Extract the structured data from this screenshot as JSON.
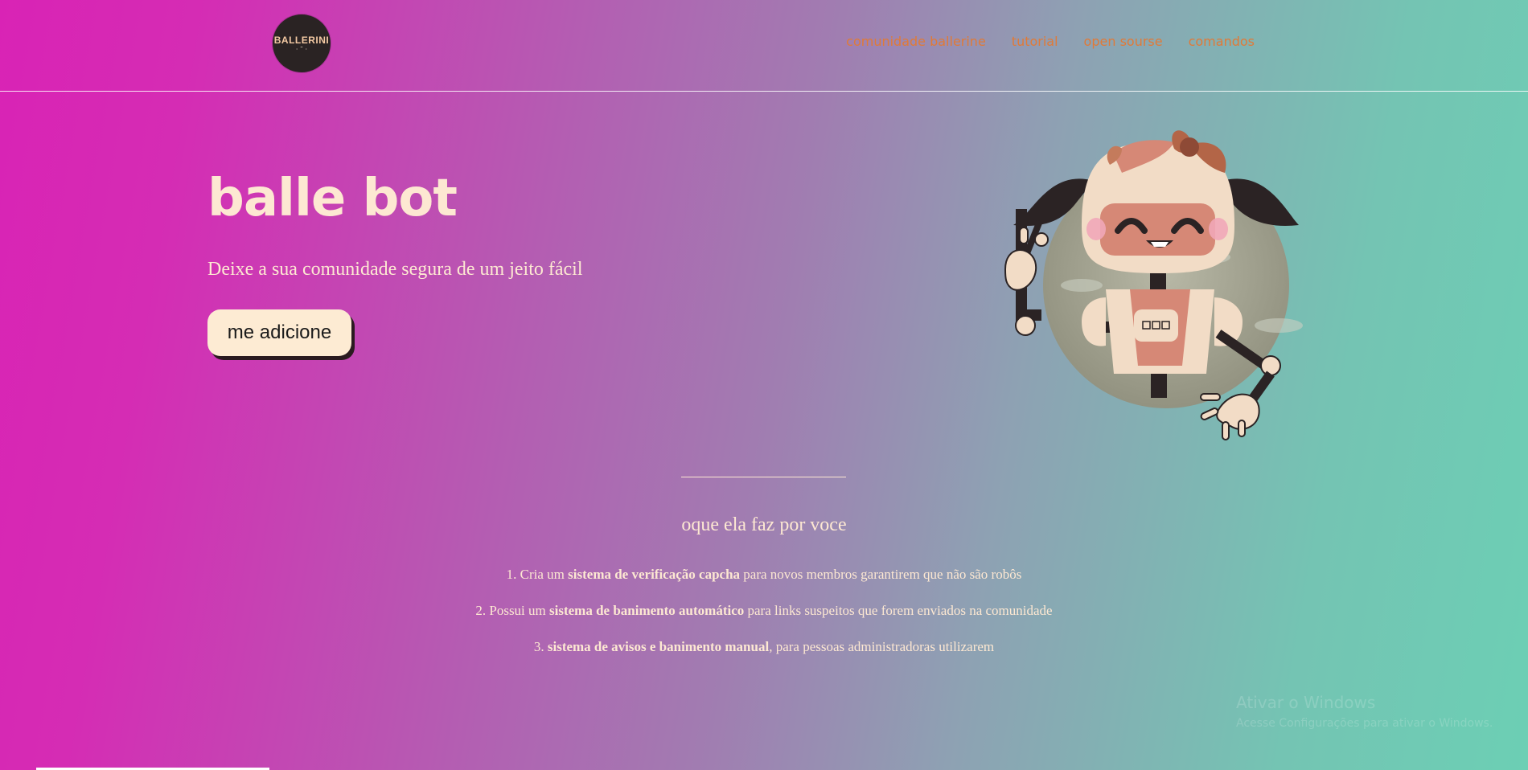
{
  "nav": {
    "logo_text": "BALLERINI",
    "links": [
      "comunidade ballerine",
      "tutorial",
      "open sourse",
      "comandos"
    ]
  },
  "hero": {
    "title": "balle bot",
    "subtitle": "Deixe a sua comunidade segura de um jeito fácil",
    "button_label": "me adicione"
  },
  "features": {
    "title": "oque ela faz por voce",
    "items": [
      {
        "num": "1. ",
        "pre": "Cria um ",
        "bold": "sistema de verificação capcha",
        "post": " para novos membros garantirem que não são robôs"
      },
      {
        "num": "2. ",
        "pre": "Possui um ",
        "bold": "sistema de banimento automático",
        "post": " para links suspeitos que forem enviados na comunidade"
      },
      {
        "num": "3. ",
        "pre": "",
        "bold": "sistema de avisos e banimento manual",
        "post": ", para pessoas administradoras utilizarem"
      }
    ]
  },
  "watermark": {
    "title": "Ativar o Windows",
    "subtitle": "Acesse Configurações para ativar o Windows."
  },
  "colors": {
    "text_light": "#fde8d2",
    "nav_link": "#e07a38",
    "button_bg": "#fdebd3",
    "gradient_left": "#d923b5",
    "gradient_right": "#6ccfb4"
  },
  "icons": [
    "ballerini-logo",
    "robot-illustration"
  ]
}
